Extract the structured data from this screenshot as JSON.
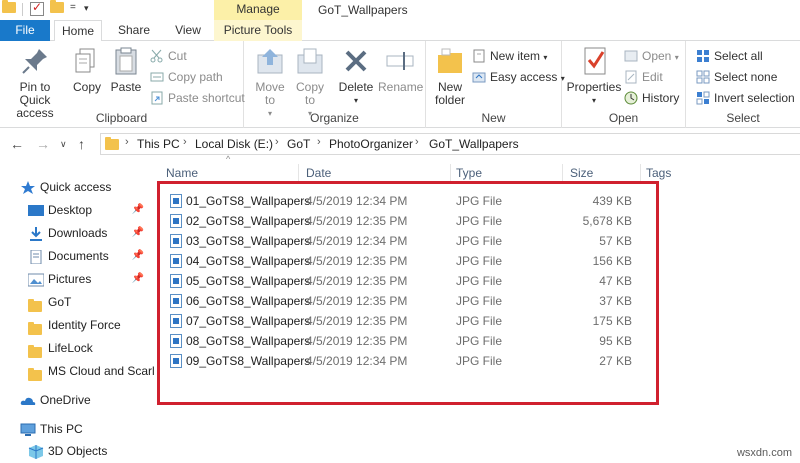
{
  "window": {
    "title": "GoT_Wallpapers",
    "contextual_tab_group": "Manage"
  },
  "tabs": [
    {
      "label": "File"
    },
    {
      "label": "Home"
    },
    {
      "label": "Share"
    },
    {
      "label": "View"
    },
    {
      "label": "Picture Tools"
    }
  ],
  "ribbon": {
    "clipboard": {
      "label": "Clipboard",
      "pin_to_quick_access_line1": "Pin to Quick",
      "pin_to_quick_access_line2": "access",
      "copy": "Copy",
      "paste": "Paste",
      "cut": "Cut",
      "copy_path": "Copy path",
      "paste_shortcut": "Paste shortcut"
    },
    "organize": {
      "label": "Organize",
      "move_to_line1": "Move",
      "move_to_line2": "to",
      "copy_to_line1": "Copy",
      "copy_to_line2": "to",
      "delete": "Delete",
      "rename": "Rename"
    },
    "new": {
      "label": "New",
      "new_folder_line1": "New",
      "new_folder_line2": "folder",
      "new_item": "New item",
      "easy_access": "Easy access"
    },
    "open": {
      "label": "Open",
      "properties": "Properties",
      "open": "Open",
      "edit": "Edit",
      "history": "History"
    },
    "select": {
      "label": "Select",
      "select_all": "Select all",
      "select_none": "Select none",
      "invert_selection": "Invert selection"
    }
  },
  "address": {
    "crumbs": [
      "This PC",
      "Local Disk (E:)",
      "GoT",
      "PhotoOrganizer",
      "GoT_Wallpapers"
    ]
  },
  "nav": {
    "quick_access": "Quick access",
    "items": [
      "Desktop",
      "Downloads",
      "Documents",
      "Pictures",
      "GoT",
      "Identity Force",
      "LifeLock",
      "MS Cloud and Scarl"
    ],
    "onedrive": "OneDrive",
    "this_pc": "This PC",
    "objects_3d": "3D Objects"
  },
  "columns": {
    "name": "Name",
    "date": "Date",
    "type": "Type",
    "size": "Size",
    "tags": "Tags"
  },
  "files": [
    {
      "name": "01_GoTS8_Wallpapers",
      "date": "4/5/2019 12:34 PM",
      "type": "JPG File",
      "size": "439 KB"
    },
    {
      "name": "02_GoTS8_Wallpapers",
      "date": "4/5/2019 12:35 PM",
      "type": "JPG File",
      "size": "5,678 KB"
    },
    {
      "name": "03_GoTS8_Wallpapers",
      "date": "4/5/2019 12:34 PM",
      "type": "JPG File",
      "size": "57 KB"
    },
    {
      "name": "04_GoTS8_Wallpapers",
      "date": "4/5/2019 12:35 PM",
      "type": "JPG File",
      "size": "156 KB"
    },
    {
      "name": "05_GoTS8_Wallpapers",
      "date": "4/5/2019 12:35 PM",
      "type": "JPG File",
      "size": "47 KB"
    },
    {
      "name": "06_GoTS8_Wallpapers",
      "date": "4/5/2019 12:35 PM",
      "type": "JPG File",
      "size": "37 KB"
    },
    {
      "name": "07_GoTS8_Wallpapers",
      "date": "4/5/2019 12:35 PM",
      "type": "JPG File",
      "size": "175 KB"
    },
    {
      "name": "08_GoTS8_Wallpapers",
      "date": "4/5/2019 12:35 PM",
      "type": "JPG File",
      "size": "95 KB"
    },
    {
      "name": "09_GoTS8_Wallpapers",
      "date": "4/5/2019 12:34 PM",
      "type": "JPG File",
      "size": "27 KB"
    }
  ],
  "watermark": "wsxdn.com",
  "colors": {
    "file_tab": "#1979ca",
    "manage_tab": "#fcf0a8",
    "highlight": "#d0202e",
    "folder": "#f3c24c"
  }
}
